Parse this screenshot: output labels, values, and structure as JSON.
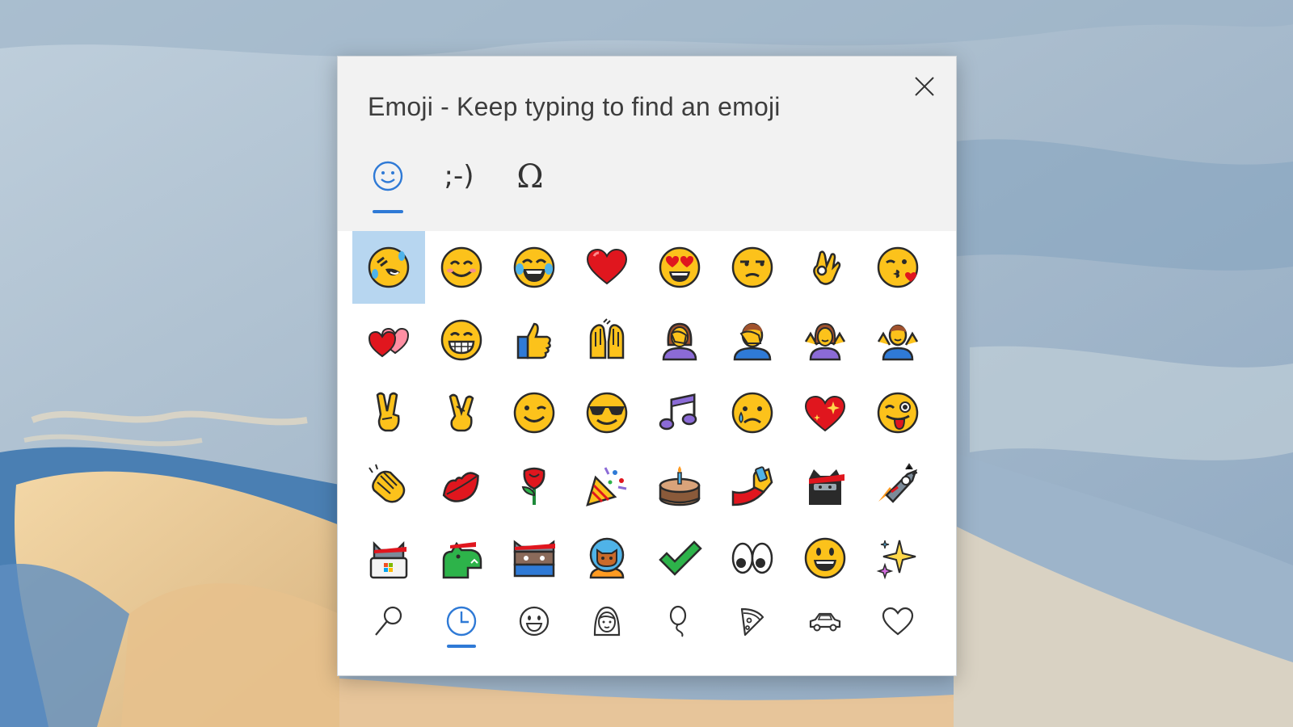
{
  "panel": {
    "title": "Emoji - Keep typing to find an emoji",
    "close_icon": "close-icon"
  },
  "mode_tabs": [
    {
      "icon": "smiley-outline-icon",
      "label": "",
      "active": true
    },
    {
      "icon": "kaomoji-icon",
      "label": ";-)",
      "active": false
    },
    {
      "icon": "omega-symbol-icon",
      "label": "Ω",
      "active": false
    }
  ],
  "emoji_grid": [
    "rolling-on-floor-laughing",
    "smiling-face-with-smiling-eyes",
    "face-with-tears-of-joy",
    "red-heart",
    "smiling-face-with-heart-eyes",
    "unamused-face",
    "ok-hand",
    "face-blowing-a-kiss",
    "two-hearts",
    "grinning-face-with-smiling-eyes",
    "thumbs-up",
    "raising-hands",
    "woman-facepalming",
    "man-facepalming",
    "woman-shrugging",
    "man-shrugging",
    "victory-hand",
    "crossed-fingers",
    "winking-face",
    "smiling-face-with-sunglasses",
    "musical-notes",
    "crying-face",
    "sparkling-heart",
    "winking-face-with-tongue",
    "clapping-hands",
    "kiss-mark",
    "rose",
    "party-popper",
    "birthday-cake",
    "selfie",
    "ninja-cat",
    "astro-cat",
    "hacker-cat",
    "dino-cat",
    "stack-cat",
    "astronaut-cat",
    "check-mark",
    "eyes",
    "grinning-face",
    "sparkles"
  ],
  "selected_emoji_index": 0,
  "categories": [
    {
      "icon": "search-icon",
      "active": false
    },
    {
      "icon": "recent-clock-icon",
      "active": true
    },
    {
      "icon": "smiley-faces-icon",
      "active": false
    },
    {
      "icon": "people-icon",
      "active": false
    },
    {
      "icon": "balloon-celebration-icon",
      "active": false
    },
    {
      "icon": "pizza-food-icon",
      "active": false
    },
    {
      "icon": "car-travel-icon",
      "active": false
    },
    {
      "icon": "heart-symbols-icon",
      "active": false
    }
  ],
  "colors": {
    "accent": "#2f7ad6",
    "selection": "#b7d6f0",
    "header_bg": "#f2f2f2"
  }
}
